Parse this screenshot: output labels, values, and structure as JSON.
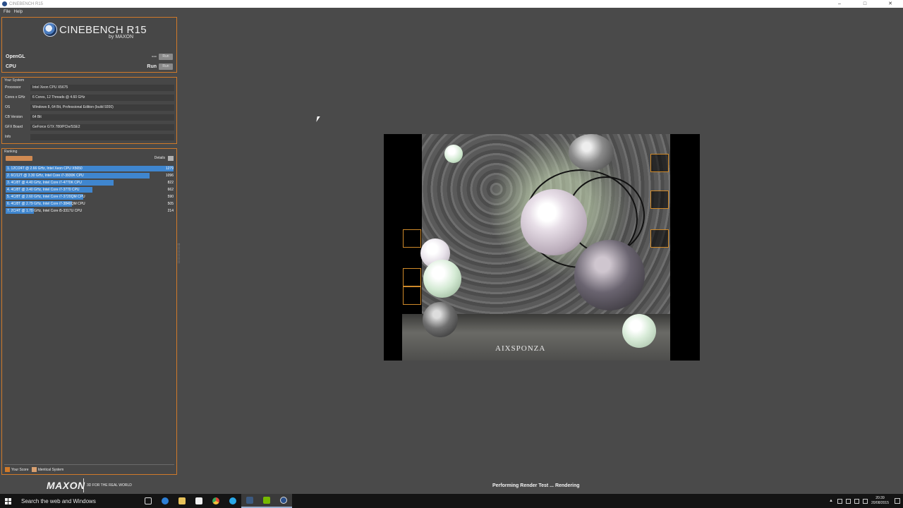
{
  "window": {
    "title": "CINEBENCH R15",
    "controls": [
      "–",
      "□",
      "✕"
    ]
  },
  "menu": {
    "items": [
      "File",
      "Help"
    ]
  },
  "logo": {
    "name": "CINEBENCH R15",
    "by": "by MAXON"
  },
  "benchmarks": [
    {
      "label": "OpenGL",
      "score": "---",
      "button": "Run"
    },
    {
      "label": "CPU",
      "score": "Run",
      "button": "Run"
    }
  ],
  "system": {
    "title": "Your System",
    "rows": [
      {
        "key": "Processor",
        "value": "Intel Xeon CPU X5675"
      },
      {
        "key": "Cores x GHz",
        "value": "6 Cores, 12 Threads @ 4.60 GHz"
      },
      {
        "key": "OS",
        "value": "Windows 8, 64 Bit, Professional Edition (build 9200)"
      },
      {
        "key": "CB Version",
        "value": "64 Bit"
      },
      {
        "key": "GFX Board",
        "value": "GeForce GTX 780/PCIe/SSE2"
      },
      {
        "key": "Info",
        "value": ""
      }
    ]
  },
  "ranking": {
    "title": "Ranking",
    "details_label": "Details",
    "max_score": 1279,
    "rows": [
      {
        "text": "1. 12C/24T @ 2.66 GHz, Intel Xeon CPU X5650",
        "score": "1279",
        "value": 1279
      },
      {
        "text": "2. 6C/12T @ 3.30 GHz,  Intel Core i7-3930K CPU",
        "score": "1096",
        "value": 1096
      },
      {
        "text": "3. 4C/8T @ 4.40 GHz, Intel Core i7-4770K CPU",
        "score": "822",
        "value": 822
      },
      {
        "text": "4. 4C/8T @ 3.40 GHz,  Intel Core i7-3770 CPU",
        "score": "662",
        "value": 662
      },
      {
        "text": "5. 4C/8T @ 2.60 GHz, Intel Core i7-3720QM CPU",
        "score": "590",
        "value": 590
      },
      {
        "text": "6. 4C/8T @ 2.79 GHz, Intel Core i7-3840QM CPU",
        "score": "505",
        "value": 505
      },
      {
        "text": "7. 2C/4T @ 1.70 GHz,  Intel Core i5-3317U CPU",
        "score": "214",
        "value": 214
      }
    ],
    "legend": {
      "your_score": "Your Score",
      "identical": "Identical System"
    }
  },
  "render": {
    "brand": "AIXSPONZA"
  },
  "branding": {
    "maxon": "MAXON",
    "tagline": "3D FOR THE REAL WORLD"
  },
  "status": {
    "text": "Performing Render Test ... Rendering"
  },
  "taskbar": {
    "search_placeholder": "Search the web and Windows",
    "icons": [
      "task-view-icon",
      "edge-icon",
      "file-explorer-icon",
      "store-icon",
      "chrome-icon",
      "skype-icon",
      "steam-icon",
      "nvidia-icon",
      "cinebench-icon"
    ],
    "clock_time": "20:39",
    "clock_date": "20/08/2015"
  },
  "colors": {
    "accent": "#d07a2a",
    "bar": "#3f86cf",
    "background": "#4a4a4a"
  }
}
